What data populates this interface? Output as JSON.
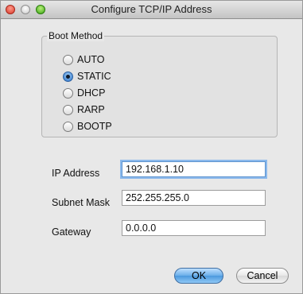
{
  "window": {
    "title": "Configure TCP/IP Address"
  },
  "boot_method": {
    "legend": "Boot Method",
    "options": [
      {
        "label": "AUTO",
        "checked": false
      },
      {
        "label": "STATIC",
        "checked": true
      },
      {
        "label": "DHCP",
        "checked": false
      },
      {
        "label": "RARP",
        "checked": false
      },
      {
        "label": "BOOTP",
        "checked": false
      }
    ]
  },
  "fields": {
    "ip_address": {
      "label": "IP Address",
      "value": "192.168.1.10"
    },
    "subnet_mask": {
      "label": "Subnet Mask",
      "value": "252.255.255.0"
    },
    "gateway": {
      "label": "Gateway",
      "value": "0.0.0.0"
    }
  },
  "buttons": {
    "ok": "OK",
    "cancel": "Cancel"
  },
  "colors": {
    "accent": "#4b98de",
    "window_bg": "#e8e8e8"
  }
}
